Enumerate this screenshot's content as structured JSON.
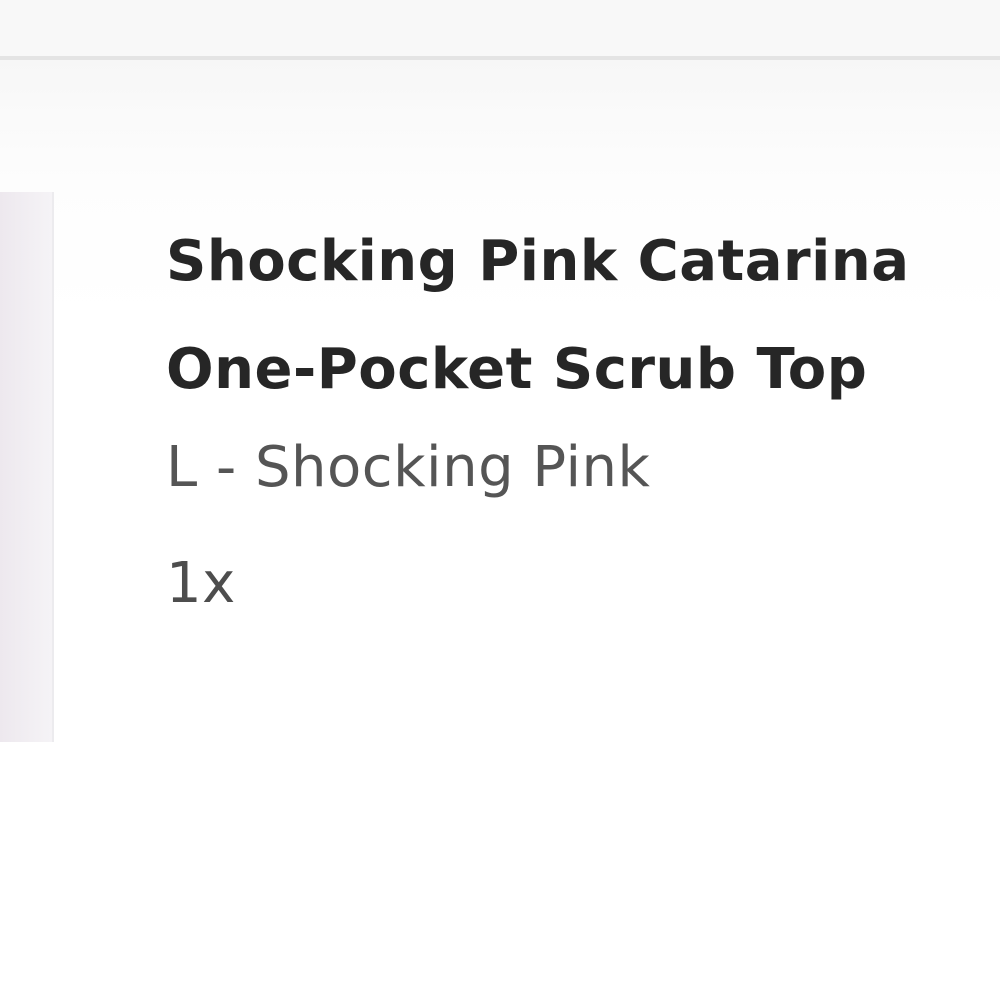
{
  "cart_item": {
    "title_line_1": "Shocking Pink Catarina",
    "title_line_2": "One-Pocket Scrub Top",
    "variant": "L - Shocking Pink",
    "quantity": "1x"
  },
  "colors": {
    "title_text": "#262626",
    "variant_text": "#555555",
    "thumbnail_tint": "#f2eff3"
  }
}
